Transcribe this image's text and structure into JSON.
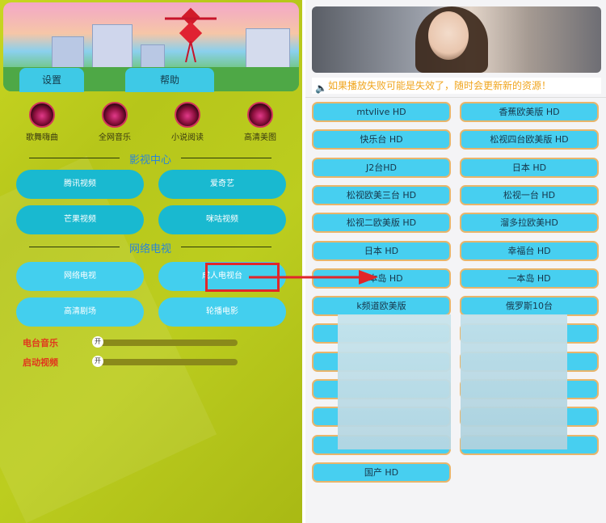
{
  "left": {
    "top_buttons": [
      "设置",
      "帮助"
    ],
    "menu": [
      {
        "label": "歌舞嗨曲",
        "icon": "music-ring-icon"
      },
      {
        "label": "全网音乐",
        "icon": "music-ring-icon"
      },
      {
        "label": "小说阅读",
        "icon": "book-ring-icon"
      },
      {
        "label": "高清美图",
        "icon": "image-ring-icon"
      }
    ],
    "section_video": "影视中心",
    "video_buttons": [
      "腾讯视频",
      "爱奇艺",
      "芒果视频",
      "咪咕视频"
    ],
    "section_tv": "网络电视",
    "tv_buttons": [
      "网络电视",
      "成人电视台",
      "高清剧场",
      "轮播电影"
    ],
    "toggles": [
      {
        "label": "电台音乐",
        "state": "开"
      },
      {
        "label": "启动视频",
        "state": "开"
      }
    ]
  },
  "right": {
    "notice": "如果播放失败可能是失效了，随时会更新新的资源！",
    "channels": [
      "mtvlive HD",
      "香蕉欧美版 HD",
      "快乐台 HD",
      "松视四台欧美版 HD",
      "J2台HD",
      "日本 HD",
      "松视欧美三台 HD",
      "松视一台 HD",
      "松视二欧美版 HD",
      "溜多拉欧美HD",
      "日本 HD",
      "幸福台 HD",
      "一本岛 HD",
      "一本岛 HD",
      "k频道欧美版",
      "俄罗斯10台",
      "",
      "",
      "",
      "",
      "",
      "",
      "",
      "",
      "",
      "",
      "国产 HD"
    ]
  },
  "colors": {
    "accent": "#47cff0",
    "highlight": "#e1252a",
    "notice": "#f0a51e"
  }
}
